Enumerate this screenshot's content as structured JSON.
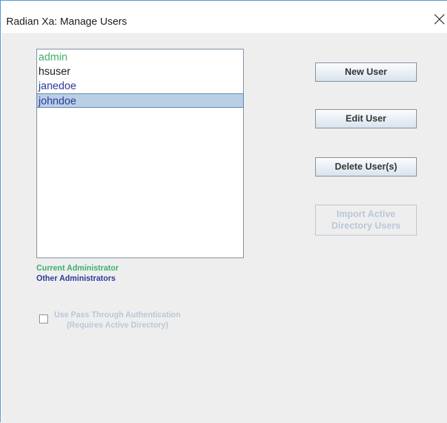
{
  "window": {
    "title": "Radian Xa: Manage Users"
  },
  "users": {
    "items": [
      {
        "name": "admin",
        "color": "#3cb06a",
        "selected": false
      },
      {
        "name": "hsuser",
        "color": "#1a1a1a",
        "selected": false
      },
      {
        "name": "janedoe",
        "color": "#2c3a9a",
        "selected": false
      },
      {
        "name": "johndoe",
        "color": "#2c3a9a",
        "selected": true
      }
    ]
  },
  "buttons": {
    "new_user": "New User",
    "edit_user": "Edit User",
    "delete_users": "Delete User(s)",
    "import_ad_line1": "Import Active",
    "import_ad_line2": "Directory Users"
  },
  "legend": {
    "current_admin": "Current Administrator",
    "current_admin_color": "#3cb06a",
    "other_admins": "Other Administrators",
    "other_admins_color": "#2c3a9a"
  },
  "pass_through": {
    "label_line1": "Use Pass Through Authentication",
    "label_line2": "(Requires Active Directory)",
    "checked": false,
    "enabled": false
  },
  "icons": {
    "close": "close-icon"
  }
}
